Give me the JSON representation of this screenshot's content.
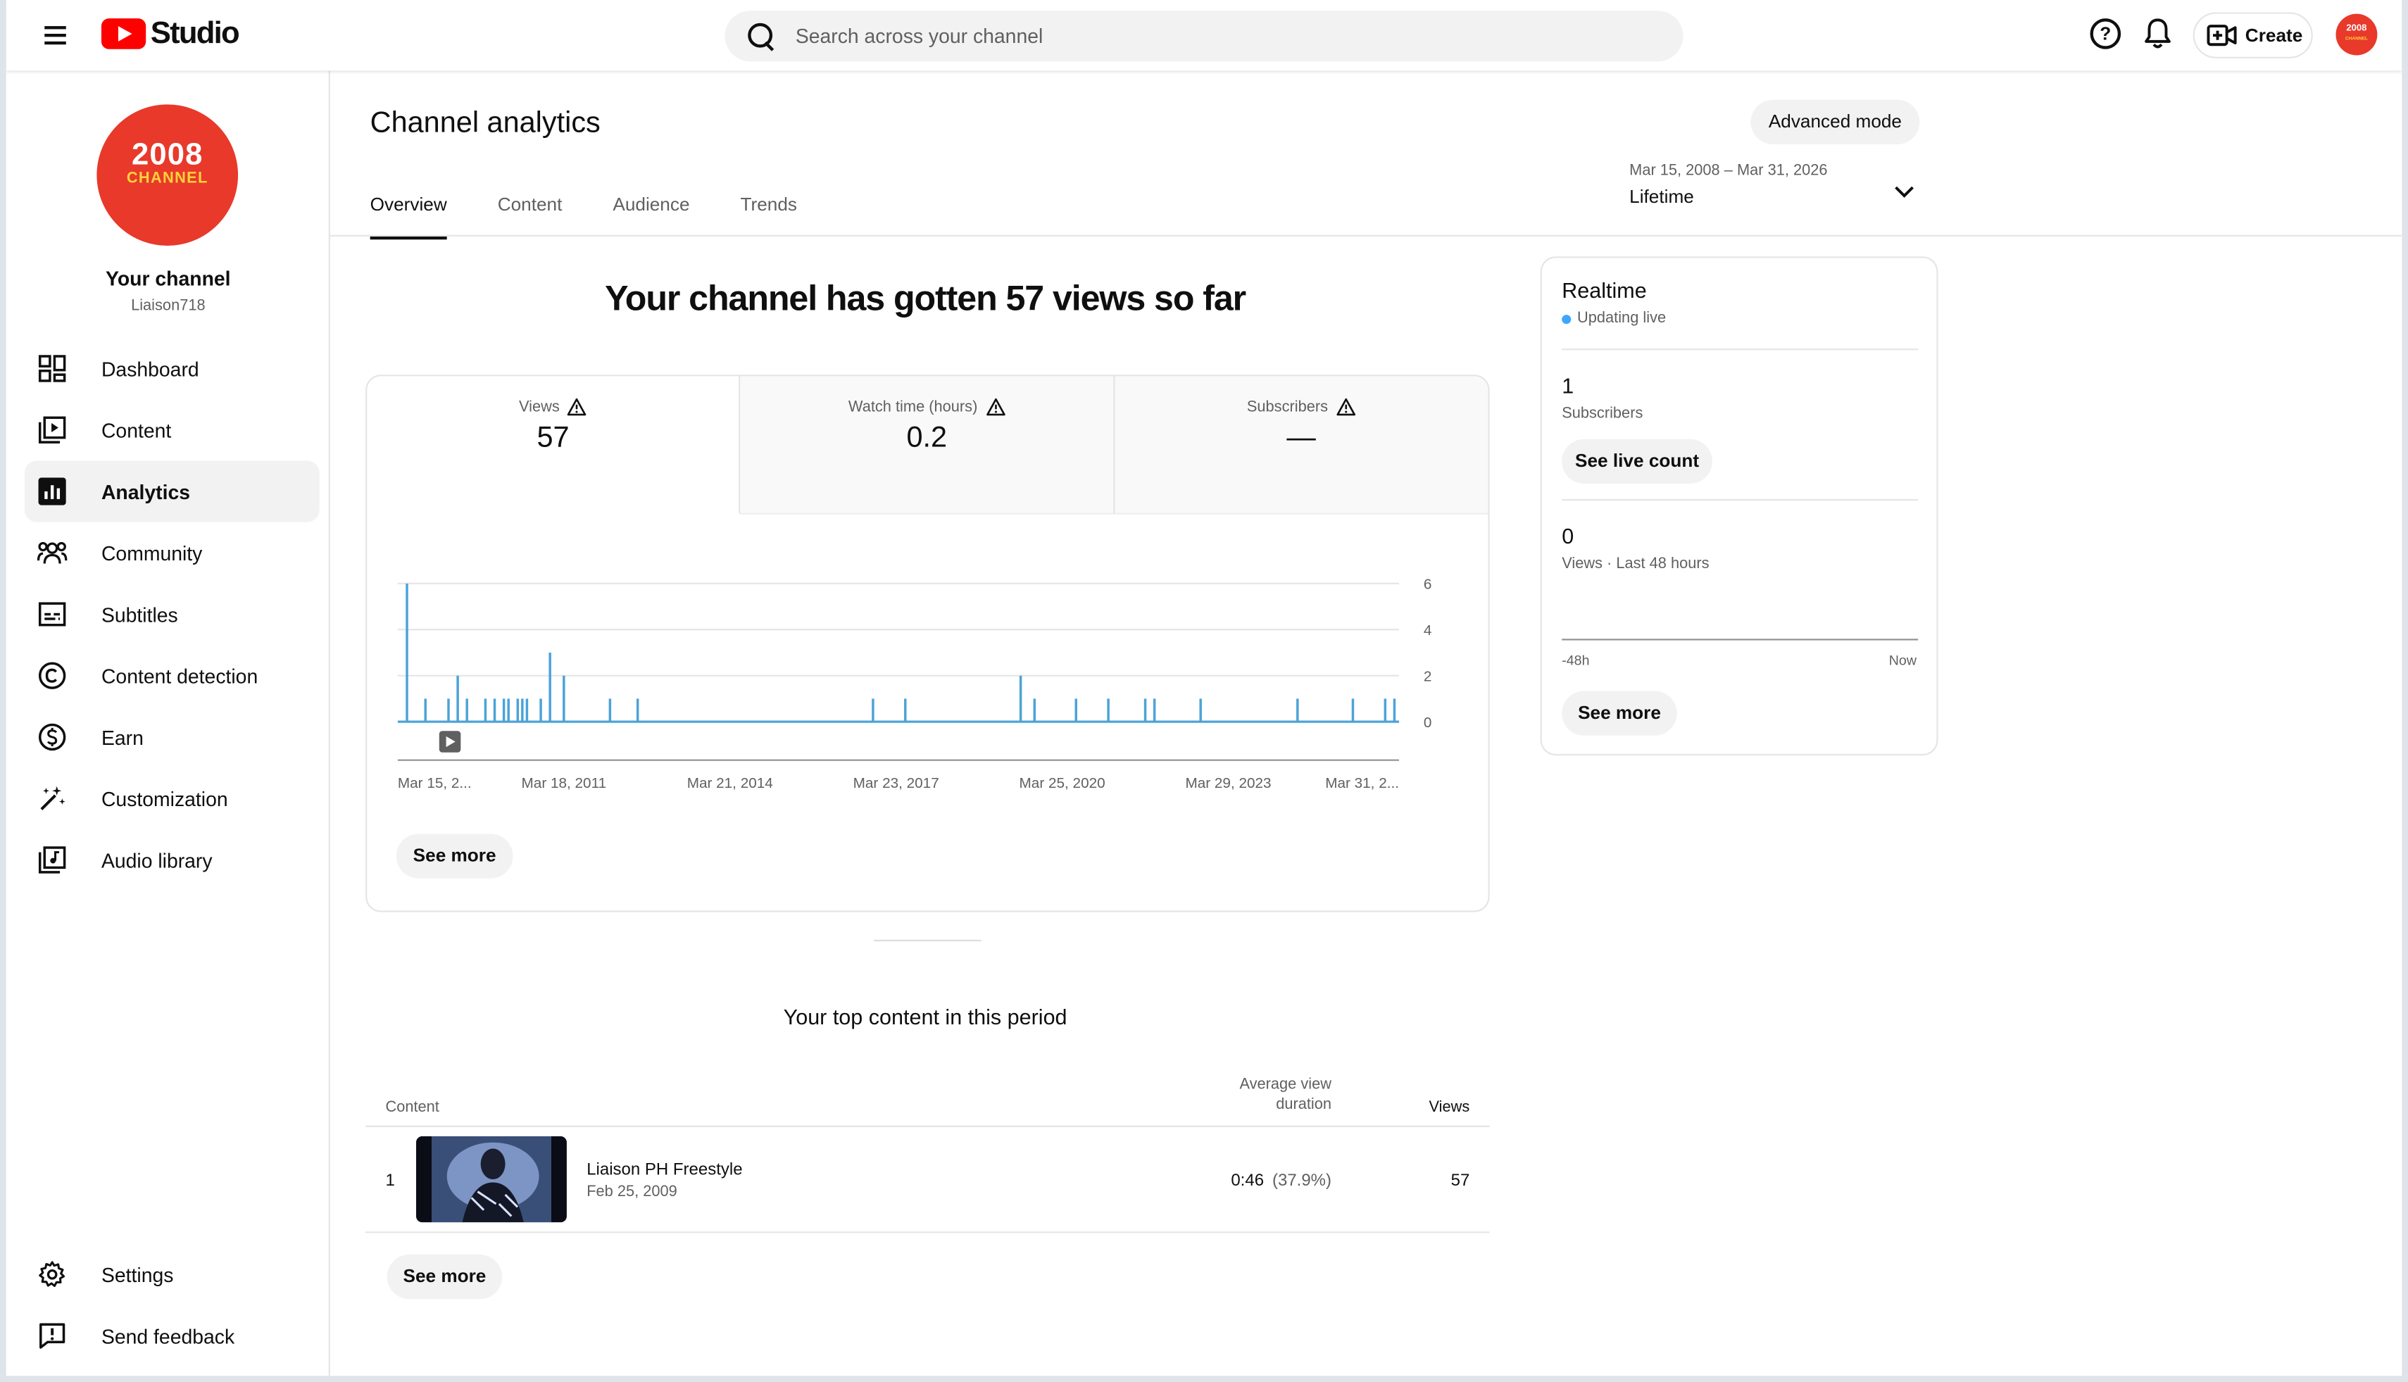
{
  "topbar": {
    "studio_label": "Studio",
    "search_placeholder": "Search across your channel",
    "create_label": "Create",
    "avatar_text_1": "2008",
    "avatar_text_2": "CHANNEL"
  },
  "sidebar": {
    "channel_avatar_line1": "2008",
    "channel_avatar_line2": "CHANNEL",
    "channel_name": "Your channel",
    "handle": "Liaison718",
    "items": [
      {
        "label": "Dashboard",
        "icon": "dashboard-icon"
      },
      {
        "label": "Content",
        "icon": "content-icon"
      },
      {
        "label": "Analytics",
        "icon": "analytics-icon",
        "active": true
      },
      {
        "label": "Community",
        "icon": "community-icon"
      },
      {
        "label": "Subtitles",
        "icon": "subtitles-icon"
      },
      {
        "label": "Content detection",
        "icon": "copyright-icon"
      },
      {
        "label": "Earn",
        "icon": "dollar-icon"
      },
      {
        "label": "Customization",
        "icon": "magic-wand-icon"
      },
      {
        "label": "Audio library",
        "icon": "audio-library-icon"
      }
    ],
    "bottom_items": [
      {
        "label": "Settings",
        "icon": "gear-icon"
      },
      {
        "label": "Send feedback",
        "icon": "feedback-icon"
      }
    ]
  },
  "main": {
    "title": "Channel analytics",
    "advanced_mode": "Advanced mode",
    "tabs": [
      "Overview",
      "Content",
      "Audience",
      "Trends"
    ],
    "active_tab": "Overview",
    "date_range": "Mar 15, 2008 – Mar 31, 2026",
    "date_period": "Lifetime",
    "headline": "Your channel has gotten 57 views so far",
    "metrics": [
      {
        "label": "Views",
        "value": "57"
      },
      {
        "label": "Watch time (hours)",
        "value": "0.2"
      },
      {
        "label": "Subscribers",
        "value": "—"
      }
    ],
    "chart_see_more": "See more",
    "top_content_title": "Your top content in this period",
    "table_headers": {
      "content": "Content",
      "avg_duration_line1": "Average view",
      "avg_duration_line2": "duration",
      "views": "Views"
    },
    "top_rows": [
      {
        "rank": "1",
        "title": "Liaison PH Freestyle",
        "date": "Feb 25, 2009",
        "duration": "0:46",
        "percent": "(37.9%)",
        "views": "57"
      }
    ],
    "table_see_more": "See more"
  },
  "realtime": {
    "title": "Realtime",
    "status": "Updating live",
    "subscribers_value": "1",
    "subscribers_label": "Subscribers",
    "see_live_count": "See live count",
    "views_value": "0",
    "views_label": "Views · Last 48 hours",
    "axis_start": "-48h",
    "axis_end": "Now",
    "see_more": "See more"
  },
  "chart_data": {
    "type": "bar",
    "series": [
      {
        "name": "Views",
        "color": "#4ca3d8"
      }
    ],
    "x_tick_labels": [
      "Mar 15, 2...",
      "Mar 18, 2011",
      "Mar 21, 2014",
      "Mar 23, 2017",
      "Mar 25, 2020",
      "Mar 29, 2023",
      "Mar 31, 2..."
    ],
    "y_ticks": [
      0,
      2,
      4,
      6
    ],
    "ylim": [
      0,
      6
    ],
    "grid": true,
    "points": [
      {
        "date": "2008-05",
        "value": 6
      },
      {
        "date": "2008-09",
        "value": 1
      },
      {
        "date": "2009-02",
        "value": 1
      },
      {
        "date": "2009-04",
        "value": 2
      },
      {
        "date": "2009-06",
        "value": 1
      },
      {
        "date": "2009-10",
        "value": 1
      },
      {
        "date": "2009-12",
        "value": 1
      },
      {
        "date": "2010-02",
        "value": 1
      },
      {
        "date": "2010-03",
        "value": 1
      },
      {
        "date": "2010-05",
        "value": 1
      },
      {
        "date": "2010-06",
        "value": 1
      },
      {
        "date": "2010-07",
        "value": 1
      },
      {
        "date": "2010-10",
        "value": 1
      },
      {
        "date": "2010-12",
        "value": 3
      },
      {
        "date": "2011-03",
        "value": 2
      },
      {
        "date": "2012-01",
        "value": 1
      },
      {
        "date": "2012-07",
        "value": 1
      },
      {
        "date": "2016-10",
        "value": 1
      },
      {
        "date": "2017-05",
        "value": 1
      },
      {
        "date": "2019-06",
        "value": 2
      },
      {
        "date": "2019-09",
        "value": 1
      },
      {
        "date": "2020-06",
        "value": 1
      },
      {
        "date": "2021-01",
        "value": 1
      },
      {
        "date": "2021-09",
        "value": 1
      },
      {
        "date": "2021-11",
        "value": 1
      },
      {
        "date": "2022-09",
        "value": 1
      },
      {
        "date": "2024-06",
        "value": 1
      },
      {
        "date": "2025-06",
        "value": 1
      },
      {
        "date": "2026-01",
        "value": 1
      },
      {
        "date": "2026-03",
        "value": 1
      }
    ]
  }
}
